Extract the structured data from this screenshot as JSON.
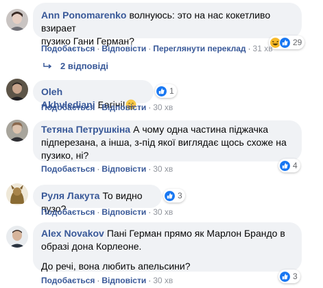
{
  "actions": {
    "like": "Подобається",
    "reply": "Відповісти",
    "see_translation": "Переглянути переклад",
    "separator": "·"
  },
  "comments": [
    {
      "author": "Ann Ponomarenko",
      "line1": "волнуюсь: это на нас кокетливо взирает",
      "line2": "пузико Гани Герман?",
      "time": "31 хв",
      "reaction_count": "29",
      "reaction_icons": [
        "laugh-icon",
        "like-icon"
      ]
    },
    {
      "author": "Oleh Akhvlediani",
      "line1": "Багіні!",
      "emoji": "smile",
      "time": "30 хв",
      "reaction_count": "1",
      "reaction_icons": [
        "like-icon"
      ]
    },
    {
      "author": "Тетяна Петрушкіна",
      "line1": "А чому одна частина піджачка",
      "line2": "підперезана, а інша, з-під якої виглядає щось схоже на",
      "line3": "пузико, ні?",
      "time": "30 хв",
      "reaction_count": "4",
      "reaction_icons": [
        "like-icon"
      ]
    },
    {
      "author": "Руля Лакута",
      "line1": "То видно пузо?",
      "time": "30 хв",
      "reaction_count": "3",
      "reaction_icons": [
        "like-icon"
      ]
    },
    {
      "author": "Alex Novakov",
      "line1": "Пані Герман прямо як Марлон Брандо в",
      "line2": "образі дона Корлеоне.",
      "line3": "До речі, вона любить апельсини?",
      "time": "30 хв",
      "reaction_count": "3",
      "reaction_icons": [
        "like-icon"
      ]
    }
  ],
  "replies_link": "2 відповіді",
  "colors": {
    "link": "#385898",
    "bubble": "#f0f2f5",
    "like_blue": "#1877f2",
    "haha_yellow": "#f7b928"
  }
}
